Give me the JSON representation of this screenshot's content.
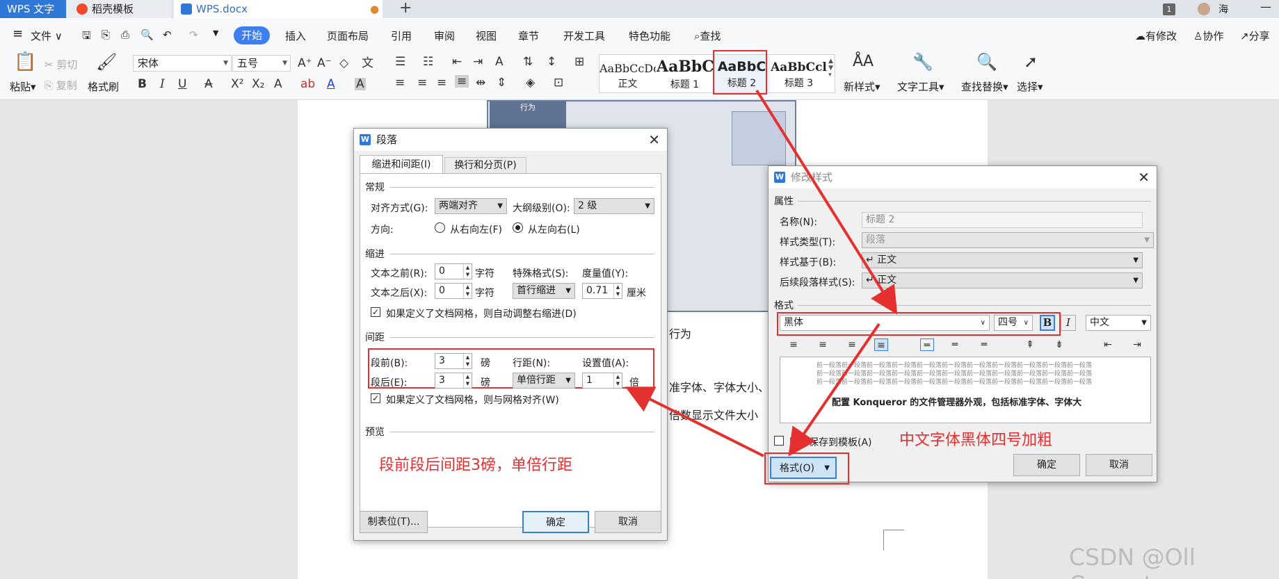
{
  "window": {
    "tabs": [
      {
        "label": "WPS 文字"
      },
      {
        "label": "稻壳模板"
      },
      {
        "label": "WPS.docx"
      }
    ],
    "new_tab": "+",
    "page_badge": "1",
    "user": "海"
  },
  "menubar": {
    "file": "文件",
    "items": [
      "开始",
      "插入",
      "页面布局",
      "引用",
      "审阅",
      "视图",
      "章节",
      "开发工具",
      "特色功能"
    ],
    "search": "查找",
    "right": [
      "有修改",
      "协作",
      "分享"
    ]
  },
  "ribbon": {
    "paste": "粘贴",
    "cut": "剪切",
    "copy": "复制",
    "format_painter": "格式刷",
    "font_name": "宋体",
    "font_size": "五号",
    "styles": [
      {
        "preview": "AaBbCcDc",
        "name": "正文"
      },
      {
        "preview": "AaBbC",
        "name": "标题 1"
      },
      {
        "preview": "AaBbC",
        "name": "标题 2"
      },
      {
        "preview": "AaBbCcl",
        "name": "标题 3"
      }
    ],
    "new_style": "新样式",
    "text_tools": "文字工具",
    "find_replace": "查找替换",
    "select": "选择"
  },
  "doc": {
    "fragment1": "行为",
    "fragment2": "准字体、字体大小、",
    "fragment3": "倍数显示文件大小",
    "shot_label": "行为"
  },
  "paragraph_dialog": {
    "title": "段落",
    "tabs": [
      "缩进和间距(I)",
      "换行和分页(P)"
    ],
    "general": {
      "label": "常规",
      "alignment_label": "对齐方式(G):",
      "alignment": "两端对齐",
      "outline_label": "大纲级别(O):",
      "outline": "2 级",
      "direction_label": "方向:",
      "rtl": "从右向左(F)",
      "ltr": "从左向右(L)"
    },
    "indent": {
      "label": "缩进",
      "before_label": "文本之前(R):",
      "before": "0",
      "after_label": "文本之后(X):",
      "after": "0",
      "unit": "字符",
      "special_label": "特殊格式(S):",
      "special": "首行缩进",
      "measure_label": "度量值(Y):",
      "measure": "0.71",
      "measure_unit": "厘米",
      "grid_check": "如果定义了文档网格，则自动调整右缩进(D)"
    },
    "spacing": {
      "label": "间距",
      "before_label": "段前(B):",
      "before": "3",
      "after_label": "段后(E):",
      "after": "3",
      "unit": "磅",
      "line_label": "行距(N):",
      "line": "单倍行距",
      "value_label": "设置值(A):",
      "value": "1",
      "value_unit": "倍",
      "grid_check": "如果定义了文档网格，则与网格对齐(W)"
    },
    "preview_label": "预览",
    "annotation": "段前段后间距3磅，单倍行距",
    "tabs_button": "制表位(T)...",
    "ok": "确定",
    "cancel": "取消"
  },
  "modify_dialog": {
    "title": "修改样式",
    "props_label": "属性",
    "name_label": "名称(N):",
    "name": "标题 2",
    "type_label": "样式类型(T):",
    "type": "段落",
    "based_label": "样式基于(B):",
    "based": "↵ 正文",
    "next_label": "后续段落样式(S):",
    "next": "↵ 正文",
    "format_label": "格式",
    "font": "黑体",
    "size": "四号",
    "bold": "B",
    "italic": "I",
    "lang": "中文",
    "preview_prev": "前一段落前一段落前一段落前一段落前一段落前一段落前一段落前一段落前一段落前一段落前一段落",
    "preview_main": "配置 Konqueror 的文件管理器外观，包括标准字体、字体大",
    "template_check": "同时保存到模板(A)",
    "format_button": "格式(O)",
    "ok": "确定",
    "cancel": "取消",
    "annotation": "中文字体黑体四号加粗"
  },
  "watermark": "CSDN @Oll Correct",
  "colors": {
    "accent": "#3d7ef0",
    "annotation": "#e53030"
  }
}
